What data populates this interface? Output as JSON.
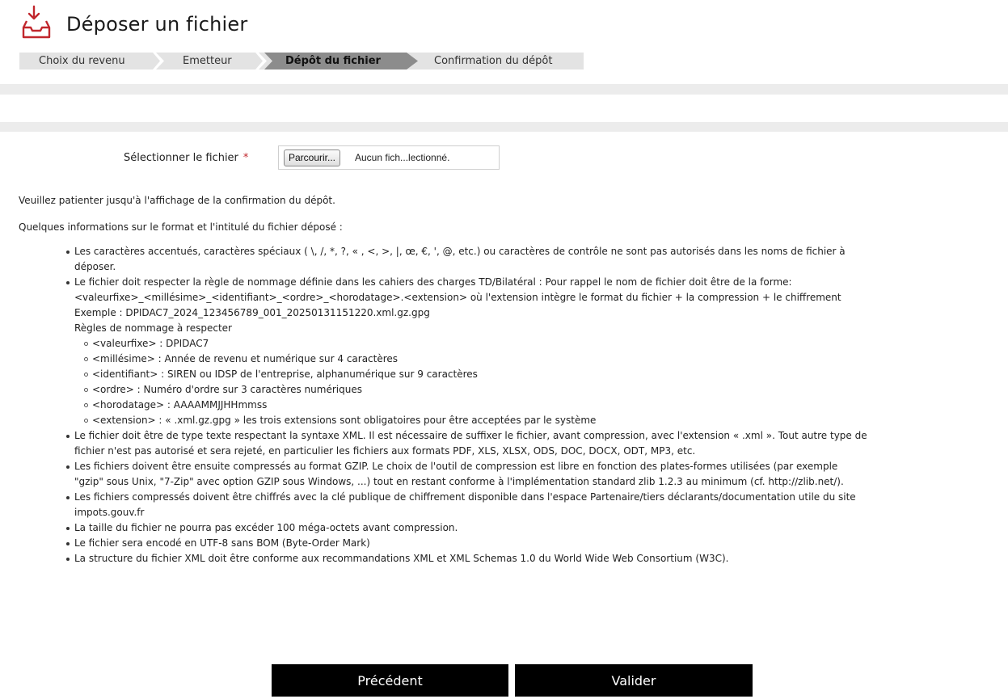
{
  "page": {
    "title": "Déposer un fichier",
    "icon": "inbox-download-icon",
    "accent_color": "#c1272d"
  },
  "steps": [
    {
      "label": "Choix du revenu",
      "active": false
    },
    {
      "label": "Emetteur",
      "active": false
    },
    {
      "label": "Dépôt du fichier",
      "active": true
    },
    {
      "label": "Confirmation du dépôt",
      "active": false
    }
  ],
  "form": {
    "file_label": "Sélectionner le fichier",
    "required_marker": "*",
    "browse_label": "Parcourir...",
    "file_status": "Aucun fich...lectionné."
  },
  "notice": "Veuillez patienter jusqu'à l'affichage de la confirmation du dépôt.",
  "intro": "Quelques informations sur le format et l'intitulé du fichier déposé :",
  "rules": {
    "item1": [
      "Les caractères accentués, caractères spéciaux ( \\, /, *, ?, « , <, >, |, œ, €, ', @, etc.) ou caractères de contrôle ne sont pas autorisés dans les noms de fichier à",
      "déposer."
    ],
    "item2": [
      "Le fichier doit respecter la règle de nommage définie dans les cahiers des charges TD/Bilatéral : Pour rappel le nom de fichier doit être de la forme:",
      "<valeurfixe>_<millésime>_<identifiant>_<ordre>_<horodatage>.<extension> où l'extension intègre le format du fichier + la compression + le chiffrement",
      "Exemple : DPIDAC7_2024_123456789_001_20250131151220.xml.gz.gpg",
      "Règles de nommage à respecter"
    ],
    "naming": [
      "<valeurfixe> : DPIDAC7",
      "<millésime> : Année de revenu et numérique sur 4 caractères",
      "<identifiant> : SIREN ou IDSP de l'entreprise, alphanumérique sur 9 caractères",
      "<ordre> : Numéro d'ordre sur 3 caractères numériques",
      "<horodatage> : AAAAMMJJHHmmss",
      "<extension> : « .xml.gz.gpg » les trois extensions sont obligatoires pour être acceptées par le système"
    ],
    "item3": [
      "Le fichier doit être de type texte respectant la syntaxe XML. Il est nécessaire de suffixer le fichier, avant compression, avec l'extension « .xml ». Tout autre type de",
      "fichier n'est pas autorisé et sera rejeté, en particulier les fichiers aux formats PDF, XLS, XLSX, ODS, DOC, DOCX, ODT, MP3, etc."
    ],
    "item4": [
      "Les fichiers doivent être ensuite compressés au format GZIP. Le choix de l'outil de compression est libre en fonction des plates-formes utilisées (par exemple",
      "\"gzip\" sous Unix, \"7-Zip\" avec option GZIP sous Windows, ...) tout en restant conforme à l'implémentation standard zlib 1.2.3 au minimum (cf. http://zlib.net/)."
    ],
    "item5": [
      "Les fichiers compressés doivent être chiffrés avec la clé publique de chiffrement disponible dans l'espace Partenaire/tiers déclarants/documentation utile du site",
      "impots.gouv.fr"
    ],
    "item6": "La taille du fichier ne pourra pas excéder 100 méga-octets avant compression.",
    "item7": "Le fichier sera encodé en UTF-8 sans BOM (Byte-Order Mark)",
    "item8": "La structure du fichier XML doit être conforme aux recommandations XML et XML Schemas 1.0 du World Wide Web Consortium (W3C)."
  },
  "actions": {
    "previous_label": "Précédent",
    "submit_label": "Valider"
  }
}
